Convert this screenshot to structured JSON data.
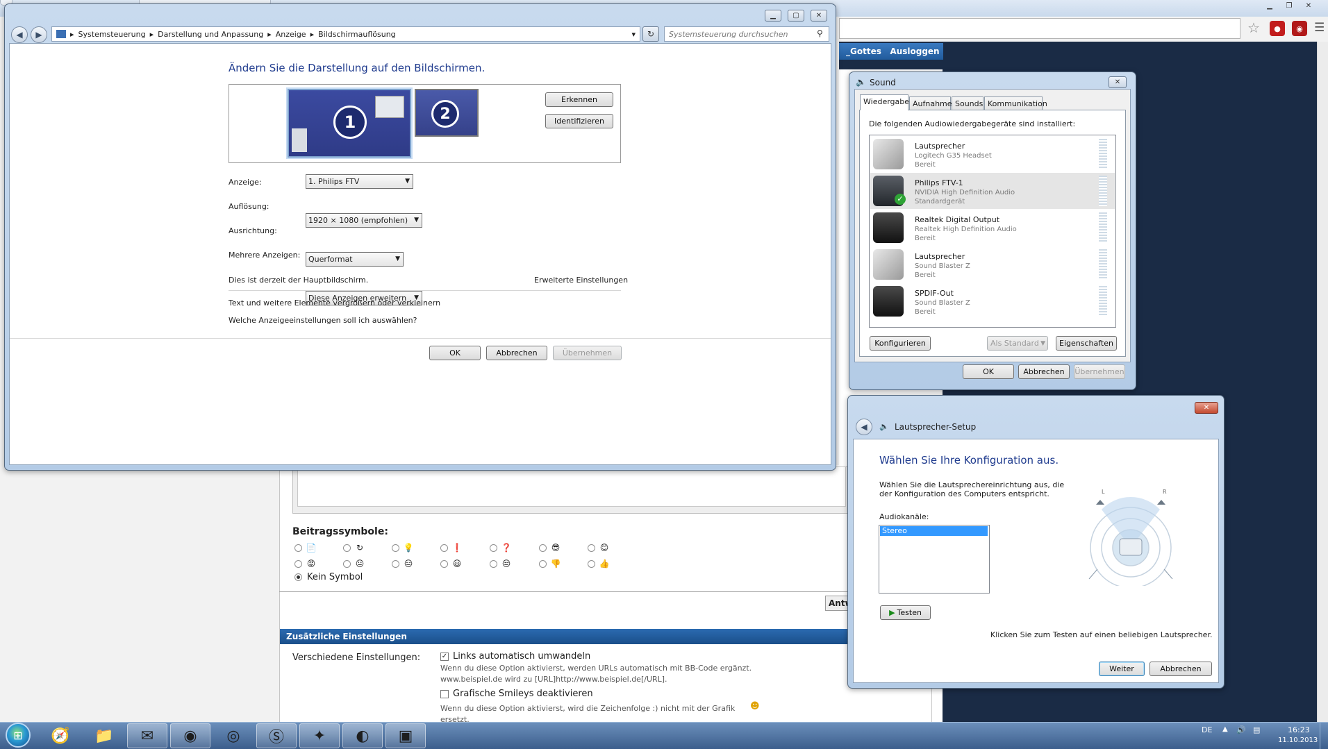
{
  "display_dialog": {
    "breadcrumb": [
      "Systemsteuerung",
      "Darstellung und Anpassung",
      "Anzeige",
      "Bildschirmauflösung"
    ],
    "search_placeholder": "Systemsteuerung durchsuchen",
    "title": "Ändern Sie die Darstellung auf den Bildschirmen.",
    "monitor1": "1",
    "monitor2": "2",
    "detect_button": "Erkennen",
    "identify_button": "Identifizieren",
    "fields": [
      {
        "label": "Anzeige:",
        "value": "1. Philips FTV"
      },
      {
        "label": "Auflösung:",
        "value": "1920 × 1080 (empfohlen)"
      },
      {
        "label": "Ausrichtung:",
        "value": "Querformat"
      },
      {
        "label": "Mehrere Anzeigen:",
        "value": "Diese Anzeigen erweitern"
      }
    ],
    "main_display_text": "Dies ist derzeit der Hauptbildschirm.",
    "advanced_link": "Erweiterte Einstellungen",
    "link1": "Text und weitere Elemente vergrößern oder verkleinern",
    "link2": "Welche Anzeigeeinstellungen soll ich auswählen?",
    "ok": "OK",
    "cancel": "Abbrechen",
    "apply": "Übernehmen"
  },
  "sound_dialog": {
    "title": "Sound",
    "tabs": [
      "Wiedergabe",
      "Aufnahme",
      "Sounds",
      "Kommunikation"
    ],
    "intro": "Die folgenden Audiowiedergabegeräte sind installiert:",
    "devices": [
      {
        "name": "Lautsprecher",
        "driver": "Logitech G35 Headset",
        "status": "Bereit",
        "icon": "speaker-icon"
      },
      {
        "name": "Philips FTV-1",
        "driver": "NVIDIA High Definition Audio",
        "status": "Standardgerät",
        "icon": "tv-icon"
      },
      {
        "name": "Realtek Digital Output",
        "driver": "Realtek High Definition Audio",
        "status": "Bereit",
        "icon": "digital-output-icon"
      },
      {
        "name": "Lautsprecher",
        "driver": "Sound Blaster Z",
        "status": "Bereit",
        "icon": "speaker-icon"
      },
      {
        "name": "SPDIF-Out",
        "driver": "Sound Blaster Z",
        "status": "Bereit",
        "icon": "digital-output-icon"
      }
    ],
    "configure": "Konfigurieren",
    "set_default": "Als Standard",
    "properties": "Eigenschaften",
    "ok": "OK",
    "cancel": "Abbrechen",
    "apply": "Übernehmen"
  },
  "setup_dialog": {
    "title": "Lautsprecher-Setup",
    "heading": "Wählen Sie Ihre Konfiguration aus.",
    "desc": "Wählen Sie die Lautsprechereinrichtung aus, die der Konfiguration des Computers entspricht.",
    "channels_label": "Audiokanäle:",
    "channels": [
      "Stereo"
    ],
    "test_button": "Testen",
    "hint": "Klicken Sie zum Testen auf einen beliebigen Lautsprecher.",
    "speaker_left": "L",
    "speaker_right": "R",
    "next": "Weiter",
    "cancel": "Abbrechen"
  },
  "forum": {
    "user_button": "_Gottes",
    "logout_button": "Ausloggen",
    "post_icons_heading": "Beitragssymbole:",
    "no_symbol": "Kein Symbol",
    "reply_button": "Antw",
    "extra_settings": "Zusätzliche Einstellungen",
    "misc_label": "Verschiedene Einstellungen:",
    "opt1_label": "Links automatisch umwandeln",
    "opt1_desc1": "Wenn du diese Option aktivierst, werden URLs automatisch mit BB-Code ergänzt.",
    "opt1_desc2": "www.beispiel.de wird zu [URL]http://www.beispiel.de[/URL].",
    "opt2_label": "Grafische Smileys deaktivieren",
    "opt2_desc1": "Wenn du diese Option aktivierst, wird die Zeichenfolge :) nicht mit der Grafik",
    "opt2_desc2": "ersetzt."
  },
  "taskbar": {
    "lang": "DE",
    "time": "16:23",
    "date": "11.10.2013"
  }
}
